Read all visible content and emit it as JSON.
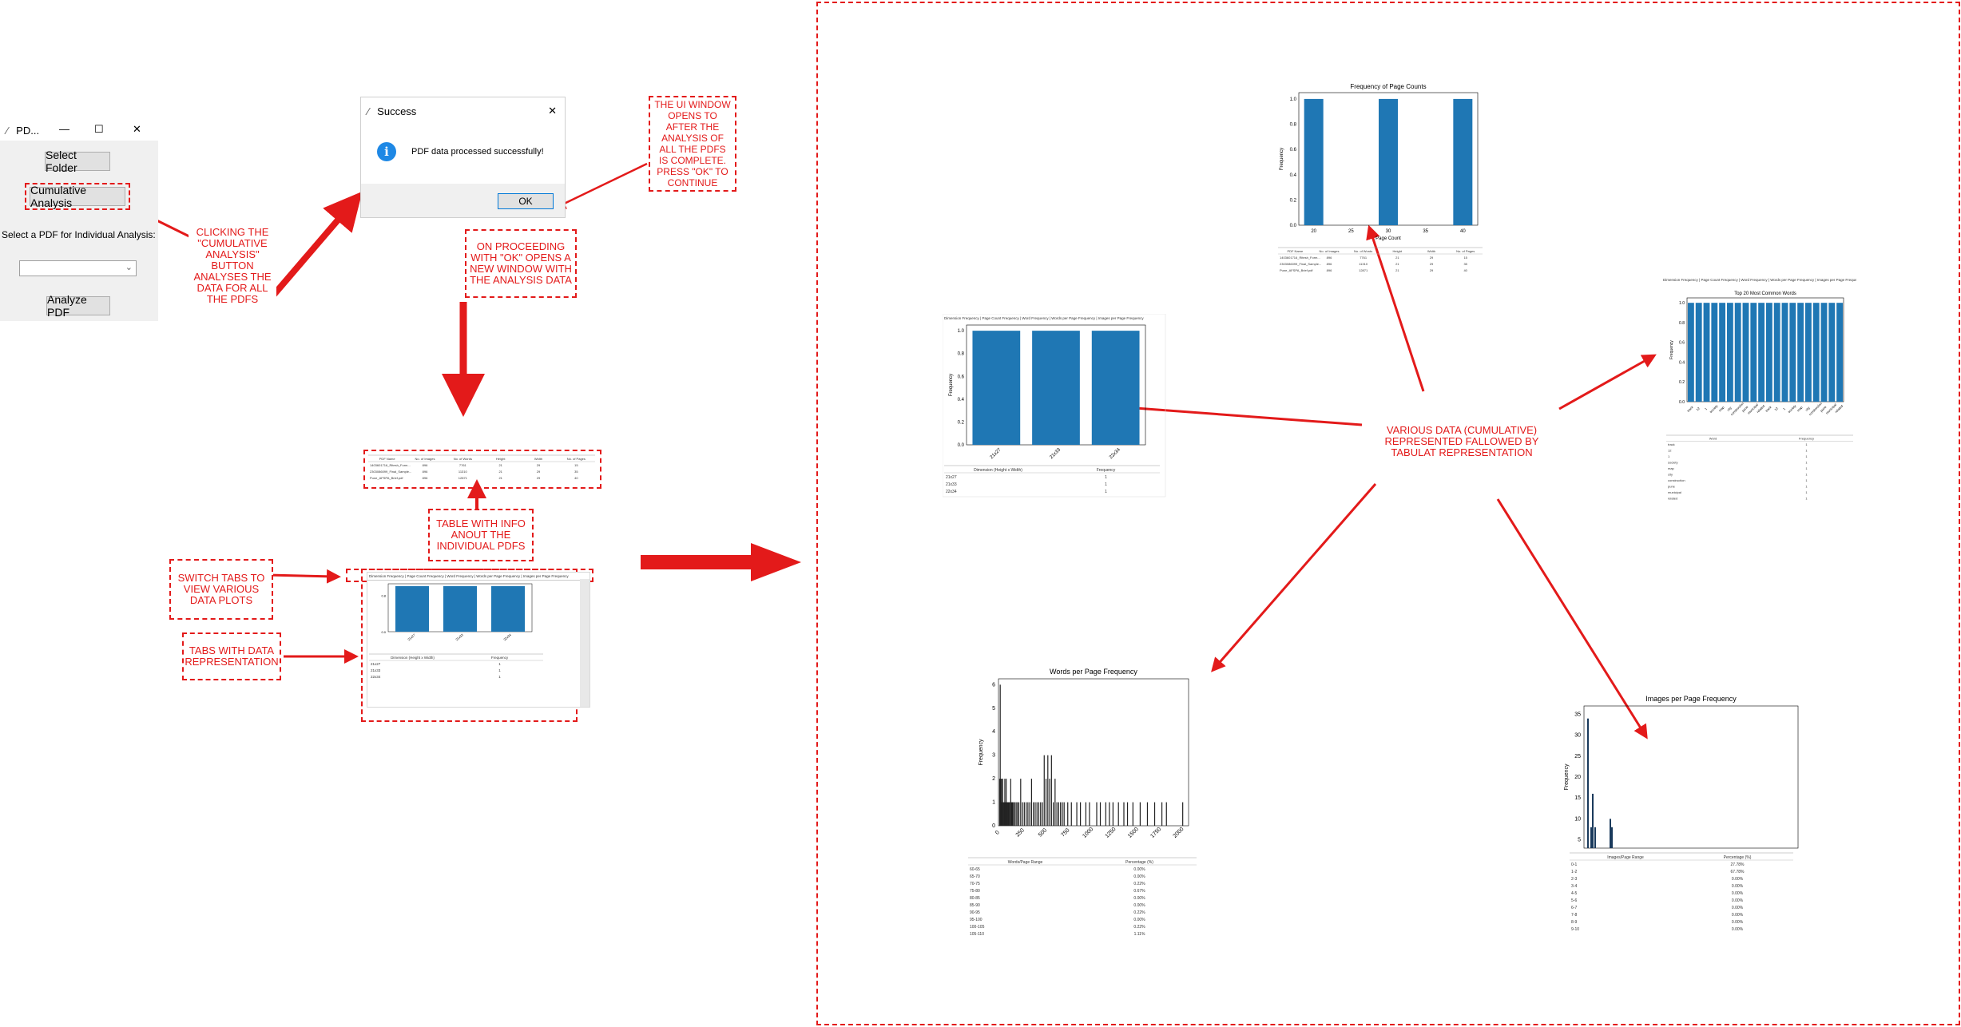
{
  "app_window": {
    "title": "PD...",
    "minimize": "—",
    "maximize": "☐",
    "close": "✕",
    "select_folder": "Select Folder",
    "cumulative_analysis": "Cumulative Analysis",
    "select_label": "Select a PDF for Individual Analysis:",
    "dropdown_value": "",
    "analyze_pdf": "Analyze PDF"
  },
  "success_dialog": {
    "title": "Success",
    "close": "✕",
    "message": "PDF data processed successfully!",
    "ok": "OK",
    "info_glyph": "i"
  },
  "notes": {
    "clicking": "CLICKING THE \"CUMULATIVE ANALYSIS\" BUTTON ANALYSES THE DATA FOR ALL THE PDFS",
    "ui_window": "THE UI WINDOW OPENS TO AFTER THE ANALYSIS OF ALL THE PDFS IS COMPLETE. PRESS \"OK\" TO CONTINUE",
    "proceeding": "ON PROCEEDING WITH \"OK\" OPENS A NEW WINDOW WITH THE ANALYSIS DATA",
    "table_info": "TABLE WITH INFO ANOUT THE INDIVIDUAL PDFS",
    "switch_tabs": "SWITCH TABS TO VIEW VARIOUS DATA PLOTS",
    "tabs_data": "TABS WITH DATA REPRESENTATION",
    "various_data": "VARIOUS DATA (CUMULATIVE) REPRESENTED FALLOWED BY TABULAT REPRESENTATION"
  },
  "individual_table": {
    "headers": [
      "PDF Name",
      "No. of Images",
      "No. of Words",
      "Height",
      "Width",
      "No. of Pages"
    ],
    "rows": [
      [
        "1403601716_Ritesh_Form...",
        "896",
        "7761",
        "21",
        "29",
        "15"
      ],
      [
        "2303086099_Final_Sample...",
        "896",
        "11310",
        "21",
        "29",
        "35"
      ],
      [
        "Pune_AFSPA_Brief.pdf",
        "896",
        "12871",
        "21",
        "29",
        "40"
      ]
    ]
  },
  "tabs_window": {
    "tabs": "Dimension Frequency | Page Count Frequency | Word Frequency | Words per Page Frequency | Images per Page Frequency",
    "col1": "Dimension (Height x Width)",
    "col2": "Frequency",
    "rows": [
      [
        "21x27",
        "1"
      ],
      [
        "21x33",
        "1"
      ],
      [
        "22x34",
        "1"
      ]
    ]
  },
  "chart_data": [
    {
      "id": "page_counts",
      "type": "bar",
      "title": "Frequency of Page Counts",
      "xlabel": "Page Count",
      "ylabel": "Frequency",
      "x": [
        20,
        30,
        40
      ],
      "values": [
        1.0,
        1.0,
        1.0
      ],
      "xticks": [
        "20",
        "25",
        "30",
        "35",
        "40"
      ],
      "yticks": [
        "0.0",
        "0.2",
        "0.4",
        "0.6",
        "0.8",
        "1.0"
      ],
      "table_headers": [
        "PDF Name",
        "No. of Images",
        "No. of Words",
        "Height",
        "Width",
        "No. of Pages"
      ],
      "table_rows": [
        [
          "1403601716_Ritesh_Form...",
          "896",
          "7761",
          "21",
          "29",
          "15"
        ],
        [
          "2303086099_Final_Sample...",
          "896",
          "11310",
          "21",
          "29",
          "35"
        ],
        [
          "Pune_AFSPA_Brief.pdf",
          "896",
          "12871",
          "21",
          "29",
          "40"
        ]
      ]
    },
    {
      "id": "dimensions",
      "type": "bar",
      "tabs": "Dimension Frequency | Page Count Frequency | Word Frequency | Words per Page Frequency | Images per Page Frequency",
      "ylabel": "Frequency",
      "categories": [
        "21x27",
        "21x33",
        "22x34"
      ],
      "values": [
        1.0,
        1.0,
        1.0
      ],
      "yticks": [
        "0.0",
        "0.2",
        "0.4",
        "0.6",
        "0.8",
        "1.0"
      ],
      "table_headers": [
        "Dimension (Height x Width)",
        "Frequency"
      ],
      "table_rows": [
        [
          "21x27",
          "1"
        ],
        [
          "21x33",
          "1"
        ],
        [
          "22x34",
          "1"
        ]
      ]
    },
    {
      "id": "common_words",
      "type": "bar",
      "title": "Top 20 Most Common Words",
      "tabs": "Dimension Frequency | Page Count Frequency | Word Frequency | Words per Page Frequency | Images per Page Frequency",
      "ylabel": "Frequency",
      "values": [
        1,
        1,
        1,
        1,
        1,
        1,
        1,
        1,
        1,
        1,
        1,
        1,
        1,
        1,
        1,
        1,
        1,
        1,
        1,
        1
      ],
      "yticks": [
        "0.0",
        "0.2",
        "0.4",
        "0.6",
        "0.8",
        "1.0"
      ],
      "table_headers": [
        "Word",
        "Frequency"
      ],
      "table_rows": [
        [
          "track",
          "1"
        ],
        [
          "12",
          "1"
        ],
        [
          "1",
          "1"
        ],
        [
          "society",
          "1"
        ],
        [
          "map",
          "1"
        ],
        [
          "city",
          "1"
        ],
        [
          "construction",
          "1"
        ],
        [
          "pune",
          "1"
        ],
        [
          "municipal",
          "1"
        ],
        [
          "related",
          "1"
        ]
      ]
    },
    {
      "id": "words_per_page",
      "type": "bar",
      "title": "Words per Page Frequency",
      "ylabel": "Frequency",
      "xticks": [
        "0",
        "250",
        "500",
        "750",
        "1000",
        "1250",
        "1500",
        "1750",
        "2000"
      ],
      "yticks": [
        "0",
        "1",
        "2",
        "3",
        "4",
        "5",
        "6"
      ],
      "xlim": [
        0,
        2100
      ],
      "ylim": [
        0,
        6
      ],
      "x": [
        8,
        14,
        22,
        28,
        35,
        42,
        50,
        58,
        65,
        72,
        80,
        88,
        95,
        104,
        112,
        120,
        130,
        140,
        150,
        160,
        175,
        190,
        205,
        220,
        240,
        260,
        280,
        300,
        320,
        340,
        360,
        380,
        400,
        420,
        440,
        460,
        480,
        500,
        520,
        540,
        560,
        580,
        600,
        620,
        640,
        660,
        680,
        700,
        720,
        760,
        800,
        860,
        900,
        960,
        1000,
        1080,
        1120,
        1180,
        1220,
        1260,
        1320,
        1380,
        1420,
        1480,
        1560,
        1640,
        1720,
        1800,
        1850,
        2030
      ],
      "values": [
        2,
        6,
        2,
        2,
        1,
        2,
        1,
        1,
        2,
        1,
        2,
        1,
        1,
        1,
        1,
        1,
        2,
        1,
        1,
        1,
        1,
        1,
        1,
        1,
        2,
        1,
        1,
        1,
        1,
        1,
        2,
        1,
        1,
        1,
        1,
        1,
        1,
        3,
        2,
        3,
        2,
        3,
        1,
        2,
        1,
        1,
        1,
        1,
        1,
        1,
        1,
        1,
        1,
        1,
        1,
        1,
        1,
        1,
        1,
        1,
        1,
        1,
        1,
        1,
        1,
        1,
        1,
        1,
        1,
        1
      ],
      "table_headers": [
        "Words/Page Range",
        "Percentage (%)"
      ],
      "table_rows": [
        [
          "60-65",
          "0.00%"
        ],
        [
          "65-70",
          "0.00%"
        ],
        [
          "70-75",
          "0.22%"
        ],
        [
          "75-80",
          "0.67%"
        ],
        [
          "80-85",
          "0.00%"
        ],
        [
          "85-90",
          "0.00%"
        ],
        [
          "90-95",
          "0.22%"
        ],
        [
          "95-100",
          "0.00%"
        ],
        [
          "100-105",
          "0.22%"
        ],
        [
          "105-110",
          "1.11%"
        ]
      ]
    },
    {
      "id": "images_per_page",
      "type": "bar",
      "title": "Images per Page Frequency",
      "ylabel": "Frequency",
      "yticks": [
        "5",
        "10",
        "15",
        "20",
        "25",
        "30",
        "35"
      ],
      "ylim": [
        3,
        37
      ],
      "x": [
        0.4,
        0.8,
        1.0,
        1.3,
        3.2,
        3.4
      ],
      "values": [
        34,
        8,
        16,
        8,
        10,
        8
      ],
      "table_headers": [
        "Images/Page Range",
        "Percentage (%)"
      ],
      "table_rows": [
        [
          "0-1",
          "27.78%"
        ],
        [
          "1-2",
          "67.78%"
        ],
        [
          "2-3",
          "0.00%"
        ],
        [
          "3-4",
          "0.00%"
        ],
        [
          "4-5",
          "0.00%"
        ],
        [
          "5-6",
          "0.00%"
        ],
        [
          "6-7",
          "0.00%"
        ],
        [
          "7-8",
          "0.00%"
        ],
        [
          "8-9",
          "0.00%"
        ],
        [
          "9-10",
          "0.00%"
        ]
      ]
    }
  ]
}
